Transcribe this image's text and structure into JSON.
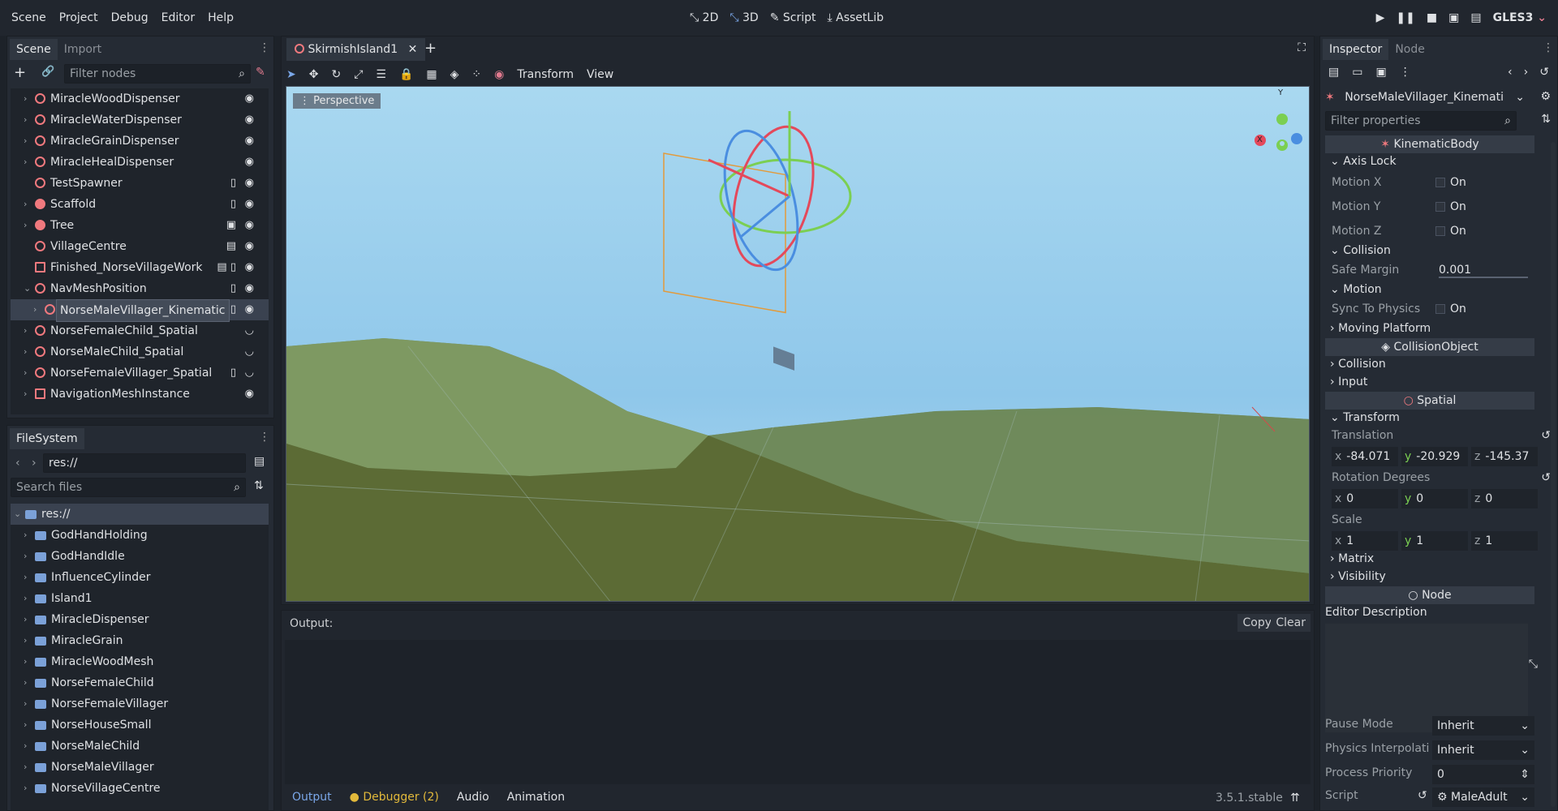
{
  "menu": [
    "Scene",
    "Project",
    "Debug",
    "Editor",
    "Help"
  ],
  "modes": {
    "m2d": "2D",
    "m3d": "3D",
    "script": "Script",
    "assetlib": "AssetLib"
  },
  "renderer": "GLES3",
  "scene_panel": {
    "tabs": [
      "Scene",
      "Import"
    ],
    "filter_placeholder": "Filter nodes",
    "nodes": [
      {
        "label": "MiracleWoodDispenser",
        "arrow": "›"
      },
      {
        "label": "MiracleWaterDispenser",
        "arrow": "›"
      },
      {
        "label": "MiracleGrainDispenser",
        "arrow": "›"
      },
      {
        "label": "MiracleHealDispenser",
        "arrow": "›"
      },
      {
        "label": "TestSpawner",
        "arrow": ""
      },
      {
        "label": "Scaffold",
        "arrow": "›"
      },
      {
        "label": "Tree",
        "arrow": "›"
      },
      {
        "label": "VillageCentre",
        "arrow": ""
      },
      {
        "label": "Finished_NorseVillageWork",
        "arrow": ""
      },
      {
        "label": "NavMeshPosition",
        "arrow": "⌄"
      },
      {
        "label": "NorseMaleVillager_Kinematic",
        "arrow": "›"
      },
      {
        "label": "NorseFemaleChild_Spatial",
        "arrow": "›"
      },
      {
        "label": "NorseMaleChild_Spatial",
        "arrow": "›"
      },
      {
        "label": "NorseFemaleVillager_Spatial",
        "arrow": "›"
      },
      {
        "label": "NavigationMeshInstance",
        "arrow": "›"
      }
    ]
  },
  "filesystem": {
    "tab": "FileSystem",
    "path": "res://",
    "search_placeholder": "Search files",
    "root": "res://",
    "folders": [
      "GodHandHolding",
      "GodHandIdle",
      "InfluenceCylinder",
      "Island1",
      "MiracleDispenser",
      "MiracleGrain",
      "MiracleWoodMesh",
      "NorseFemaleChild",
      "NorseFemaleVillager",
      "NorseHouseSmall",
      "NorseMaleChild",
      "NorseMaleVillager",
      "NorseVillageCentre"
    ]
  },
  "editor": {
    "scene_tab": "SkirmishIsland1",
    "toolbar": {
      "transform": "Transform",
      "view": "View"
    },
    "perspective": "Perspective"
  },
  "output": {
    "label": "Output:",
    "copy": "Copy",
    "clear": "Clear",
    "bottom_tabs": [
      "Output",
      "Debugger (2)",
      "Audio",
      "Animation"
    ],
    "version": "3.5.1.stable"
  },
  "inspector": {
    "tabs": [
      "Inspector",
      "Node"
    ],
    "node_name": "NorseMaleVillager_Kinemati",
    "filter_placeholder": "Filter properties",
    "kinematic": "KinematicBody",
    "axis_lock": "Axis Lock",
    "motion_x": "Motion X",
    "motion_y": "Motion Y",
    "motion_z": "Motion Z",
    "on": "On",
    "collision": "Collision",
    "safe_margin": "Safe Margin",
    "safe_margin_val": "0.001",
    "motion": "Motion",
    "sync": "Sync To Physics",
    "moving_platform": "Moving Platform",
    "collision_object": "CollisionObject",
    "collision2": "Collision",
    "input": "Input",
    "spatial": "Spatial",
    "transform": "Transform",
    "translation": "Translation",
    "tx": "-84.071",
    "ty": "-20.929",
    "tz": "-145.37",
    "rotation": "Rotation Degrees",
    "rx": "0",
    "ry": "0",
    "rz": "0",
    "scale": "Scale",
    "sx": "1",
    "sy": "1",
    "sz": "1",
    "matrix": "Matrix",
    "visibility": "Visibility",
    "node": "Node",
    "editor_desc": "Editor Description",
    "pause_mode": "Pause Mode",
    "pause_val": "Inherit",
    "phys_interp": "Physics Interpolati",
    "phys_val": "Inherit",
    "process_priority": "Process Priority",
    "process_val": "0",
    "script": "Script",
    "script_val": "MaleAdult"
  }
}
